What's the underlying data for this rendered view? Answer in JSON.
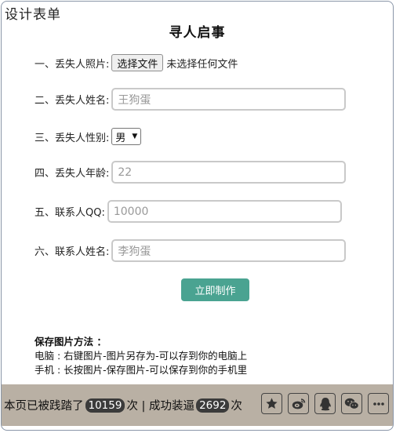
{
  "corner_title": "设计表单",
  "page_title": "寻人启事",
  "form": {
    "photo": {
      "label": "一、丢失人照片:",
      "button": "选择文件",
      "status": "未选择任何文件"
    },
    "name": {
      "label": "二、丢失人姓名:",
      "placeholder": "王狗蛋"
    },
    "gender": {
      "label": "三、丢失人性别:",
      "selected": "男"
    },
    "age": {
      "label": "四、丢失人年龄:",
      "placeholder": "22"
    },
    "qq": {
      "label": "五、联系人QQ:",
      "placeholder": "10000"
    },
    "contact_name": {
      "label": "六、联系人姓名:",
      "placeholder": "李狗蛋"
    },
    "submit": "立即制作"
  },
  "help": {
    "heading": "保存图片方法 ：",
    "line1": "电脑 : 右键图片-图片另存为-可以存到你的电脑上",
    "line2": "手机 : 长按图片-保存图片-可以保存到你的手机里"
  },
  "footer": {
    "text1": "本页已被践踏了",
    "visits": "10159",
    "text2": "次 | 成功装逼",
    "success": "2692",
    "text3": "次",
    "icons": [
      "star-icon",
      "weibo-icon",
      "qq-icon",
      "wechat-icon",
      "more-icon"
    ]
  },
  "colors": {
    "accent": "#4aa391",
    "footer_bg": "#b9b0a4",
    "border": "#8a96a8"
  }
}
